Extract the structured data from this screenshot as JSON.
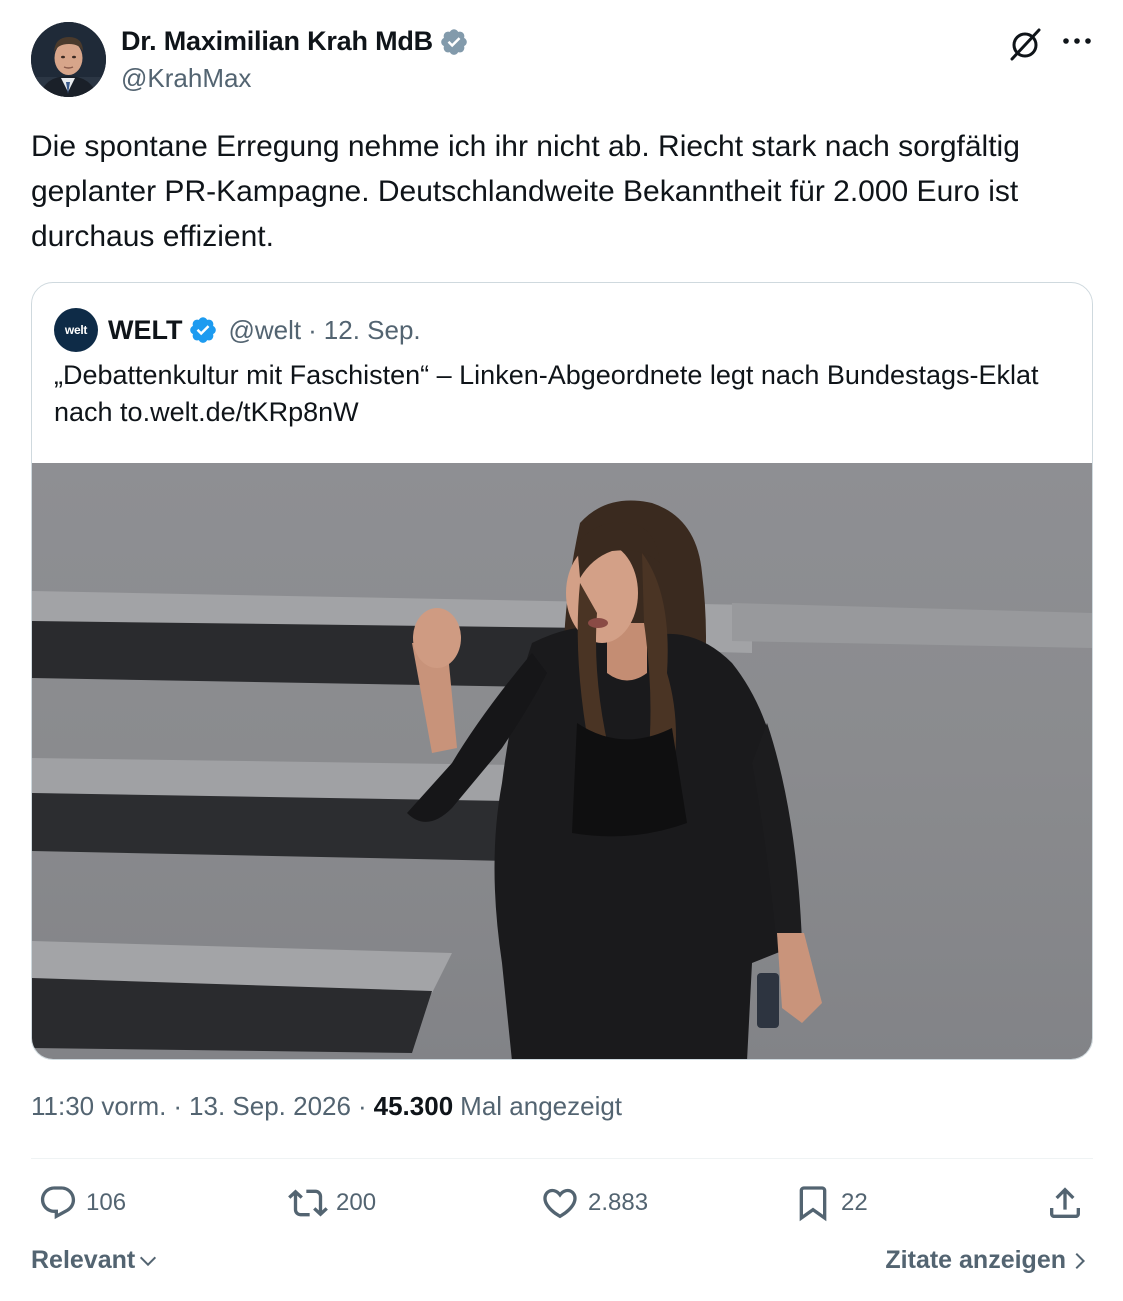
{
  "author": {
    "display_name": "Dr. Maximilian Krah MdB",
    "handle": "@KrahMax",
    "verified": "grey"
  },
  "tweet": {
    "text": "Die spontane Erregung nehme ich ihr nicht ab. Riecht stark nach sorgfältig geplanter PR-Kampagne. Deutschlandweite Bekanntheit für 2.000 Euro ist durchaus effizient."
  },
  "quote": {
    "logo_text": "welt",
    "name": "WELT",
    "handle": "@welt",
    "separator": "·",
    "date": "12. Sep.",
    "text": "„Debattenkultur mit Faschisten“ – Linken-Abgeordnete legt nach Bundestags-Eklat nach to.welt.de/tKRp8nW"
  },
  "meta": {
    "time": "11:30 vorm.",
    "separator": "·",
    "date": "13. Sep. 2026",
    "views_count": "45.300",
    "views_label": "Mal angezeigt"
  },
  "actions": {
    "replies": "106",
    "retweets": "200",
    "likes": "2.883",
    "bookmarks": "22"
  },
  "footer": {
    "sort_label": "Relevant",
    "quotes_link": "Zitate anzeigen"
  },
  "colors": {
    "text_primary": "#0f1419",
    "text_secondary": "#536471",
    "verified_blue": "#1d9bf0",
    "verified_grey": "#829aab",
    "border": "#cfd9de"
  }
}
